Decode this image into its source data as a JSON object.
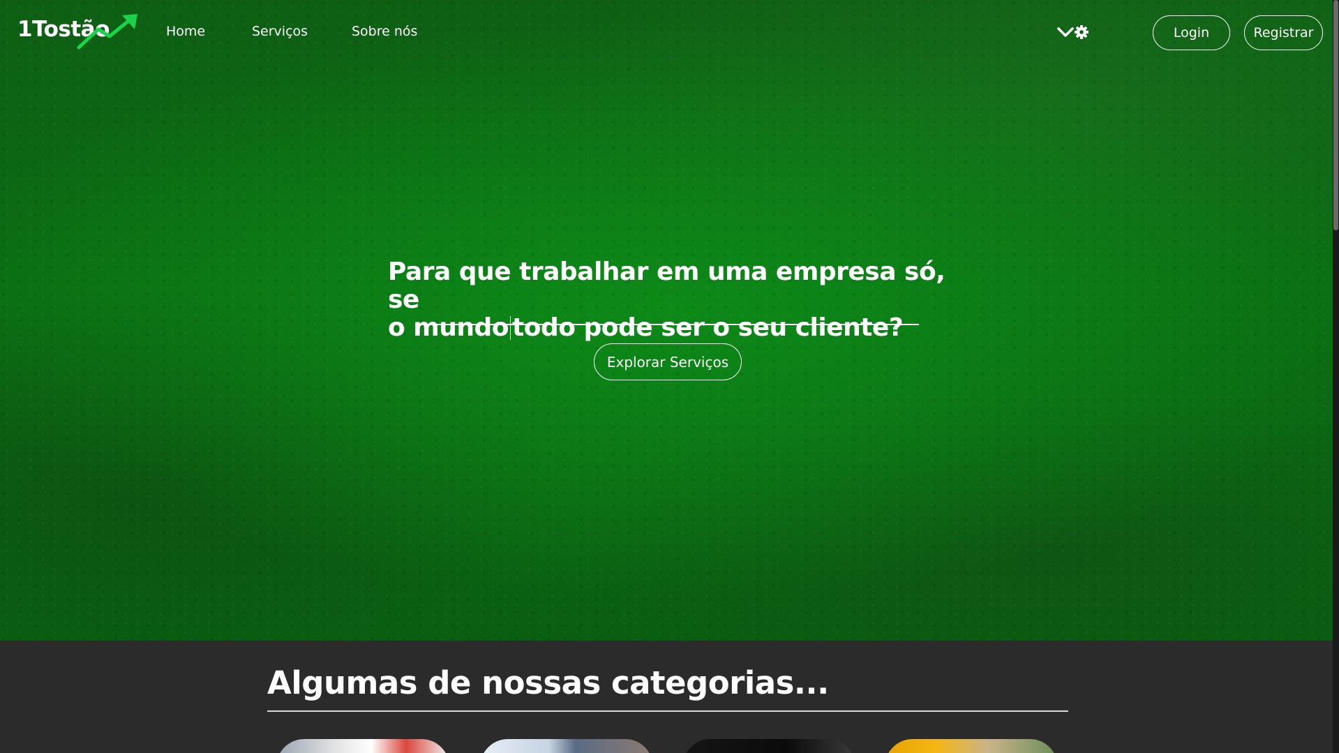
{
  "brand": {
    "name": "1Tostão",
    "accent_color": "#19d34a",
    "hero_color": "#0b6d13"
  },
  "nav": {
    "links": [
      "Home",
      "Serviços",
      "Sobre nós"
    ],
    "login_label": "Login",
    "register_label": "Registrar",
    "icons": [
      "chevron-down-icon",
      "gear-icon"
    ]
  },
  "hero": {
    "title_part1": "Para que trabalhar em uma empresa só, se",
    "title_part2_a": "o mundo",
    "title_part2_b": "todo pode ser o seu cliente?",
    "cta_label": "Explorar Serviços"
  },
  "categories": {
    "heading": "Algumas de nossas categorias...",
    "card_count_visible": 4
  }
}
